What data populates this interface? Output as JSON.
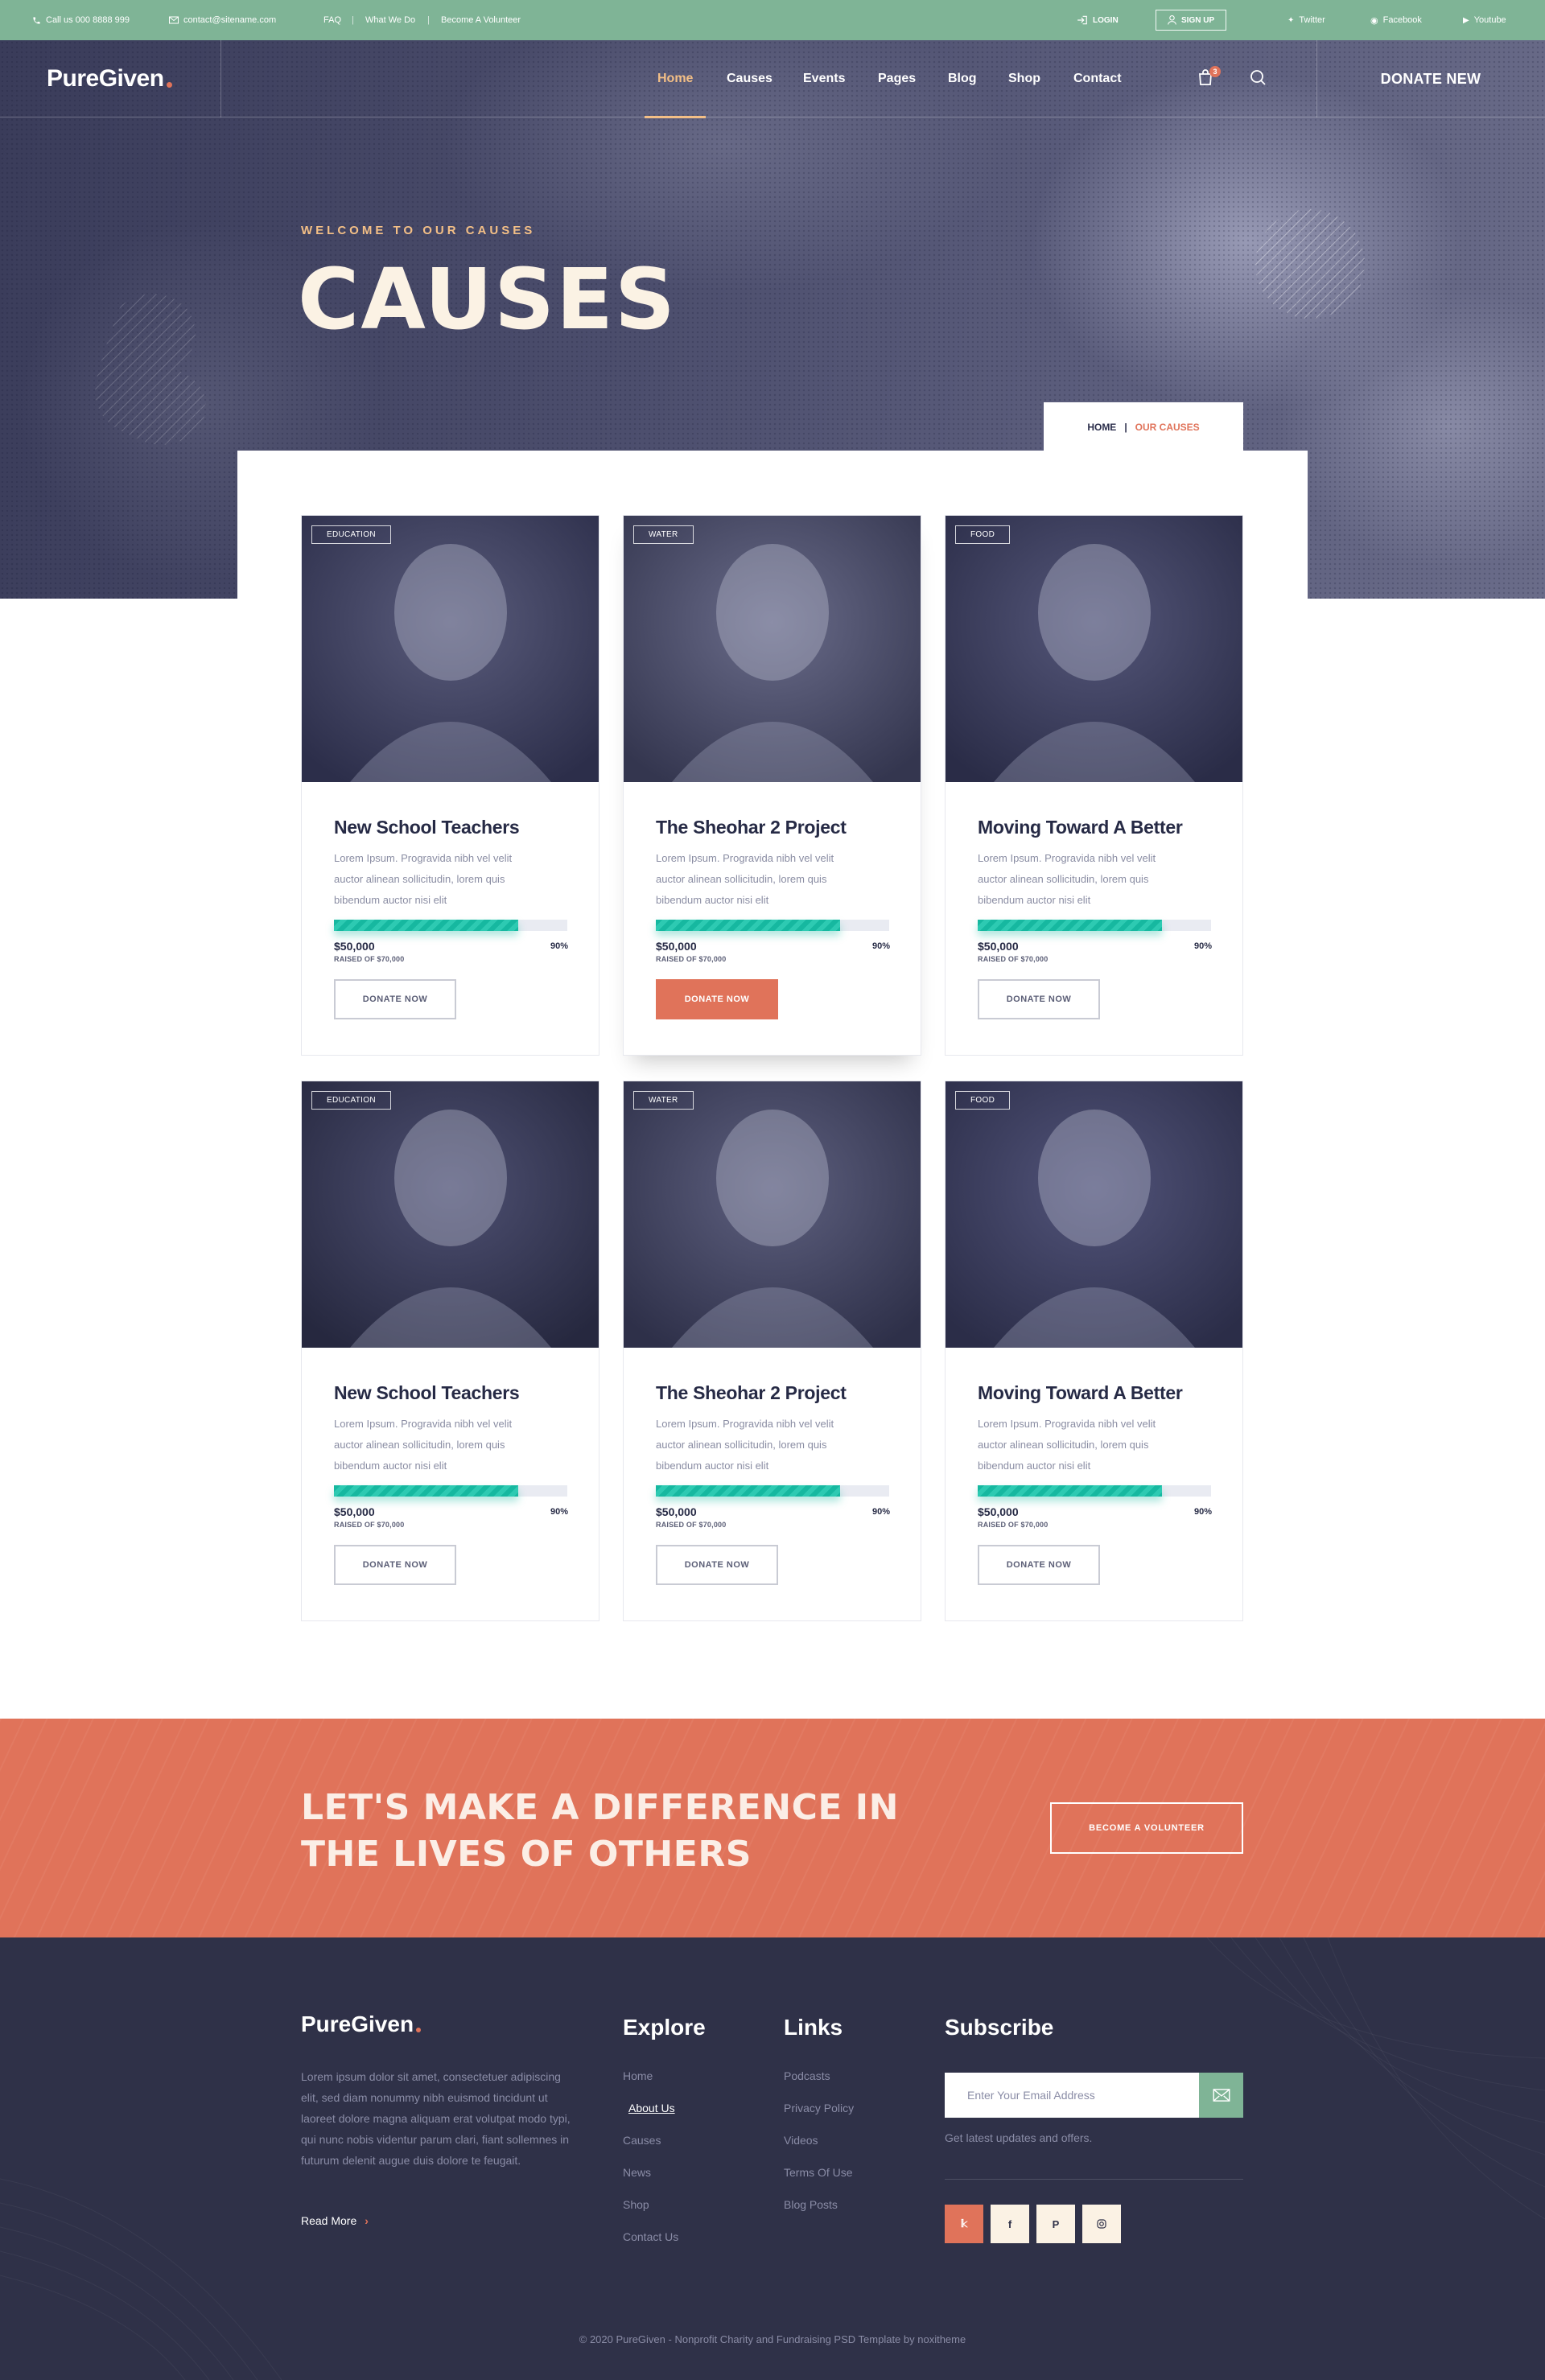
{
  "topbar": {
    "phone": "Call us 000 8888 999",
    "email": "contact@sitename.com",
    "links": [
      "FAQ",
      "What We Do",
      "Become A Volunteer"
    ],
    "login": "LOGIN",
    "signup": "SIGN UP",
    "social": [
      "Twitter",
      "Facebook",
      "Youtube"
    ]
  },
  "header": {
    "logo": "PureGiven",
    "nav": [
      "Home",
      "Causes",
      "Events",
      "Pages",
      "Blog",
      "Shop",
      "Contact"
    ],
    "active": "Home",
    "cart_count": "3",
    "donate": "DONATE NEW"
  },
  "hero": {
    "kicker": "WELCOME TO OUR CAUSES",
    "title": "CAUSES",
    "breadcrumb": {
      "home": "HOME",
      "sep": "|",
      "current": "OUR CAUSES"
    }
  },
  "causes": [
    {
      "tag": "EDUCATION",
      "title": "New School Teachers",
      "desc": "Lorem Ipsum. Progravida nibh vel velit auctor alinean sollicitudin, lorem quis bibendum auctor nisi elit",
      "raised": "$50,000",
      "goal": "RAISED OF $70,000",
      "percent_label": "90%",
      "progress": 0.79,
      "button": "DONATE NOW",
      "featured": false
    },
    {
      "tag": "WATER",
      "title": "The Sheohar 2 Project",
      "desc": "Lorem Ipsum. Progravida nibh vel velit auctor alinean sollicitudin, lorem quis bibendum auctor nisi elit",
      "raised": "$50,000",
      "goal": "RAISED OF $70,000",
      "percent_label": "90%",
      "progress": 0.79,
      "button": "DONATE NOW",
      "featured": true
    },
    {
      "tag": "FOOD",
      "title": "Moving Toward A Better",
      "desc": "Lorem Ipsum. Progravida nibh vel velit auctor alinean sollicitudin, lorem quis bibendum auctor nisi elit",
      "raised": "$50,000",
      "goal": "RAISED OF $70,000",
      "percent_label": "90%",
      "progress": 0.79,
      "button": "DONATE NOW",
      "featured": false
    },
    {
      "tag": "EDUCATION",
      "title": "New School Teachers",
      "desc": "Lorem Ipsum. Progravida nibh vel velit auctor alinean sollicitudin, lorem quis bibendum auctor nisi elit",
      "raised": "$50,000",
      "goal": "RAISED OF $70,000",
      "percent_label": "90%",
      "progress": 0.79,
      "button": "DONATE NOW",
      "featured": false
    },
    {
      "tag": "WATER",
      "title": "The Sheohar 2 Project",
      "desc": "Lorem Ipsum. Progravida nibh vel velit auctor alinean sollicitudin, lorem quis bibendum auctor nisi elit",
      "raised": "$50,000",
      "goal": "RAISED OF $70,000",
      "percent_label": "90%",
      "progress": 0.79,
      "button": "DONATE NOW",
      "featured": false
    },
    {
      "tag": "FOOD",
      "title": "Moving Toward A Better",
      "desc": "Lorem Ipsum. Progravida nibh vel velit auctor alinean sollicitudin, lorem quis bibendum auctor nisi elit",
      "raised": "$50,000",
      "goal": "RAISED OF $70,000",
      "percent_label": "90%",
      "progress": 0.79,
      "button": "DONATE NOW",
      "featured": false
    }
  ],
  "cta": {
    "line1": "LET'S MAKE A DIFFERENCE IN",
    "line2": "THE LIVES OF OTHERS",
    "button": "BECOME A VOLUNTEER"
  },
  "footer": {
    "logo": "PureGiven",
    "about": "Lorem ipsum dolor sit amet, consectetuer adipiscing elit, sed diam nonummy nibh euismod tincidunt ut laoreet dolore magna aliquam erat volutpat modo typi, qui nunc nobis videntur parum clari, fiant sollemnes in futurum delenit augue duis dolore te feugait.",
    "read_more": "Read More",
    "explore": {
      "heading": "Explore",
      "items": [
        "Home",
        "About Us",
        "Causes",
        "News",
        "Shop",
        "Contact Us"
      ]
    },
    "links": {
      "heading": "Links",
      "items": [
        "Podcasts",
        "Privacy Policy",
        "Videos",
        "Terms Of Use",
        "Blog Posts"
      ]
    },
    "subscribe": {
      "heading": "Subscribe",
      "placeholder": "Enter Your Email Address",
      "note": "Get latest updates and offers."
    },
    "copyright": "© 2020 PureGiven - Nonprofit Charity and Fundraising PSD Template by noxitheme"
  },
  "colors": {
    "accent": "#e0735a",
    "green": "#7fb496",
    "teal": "#16b8a0",
    "navy": "#2f3148",
    "gold": "#f3bf86"
  }
}
